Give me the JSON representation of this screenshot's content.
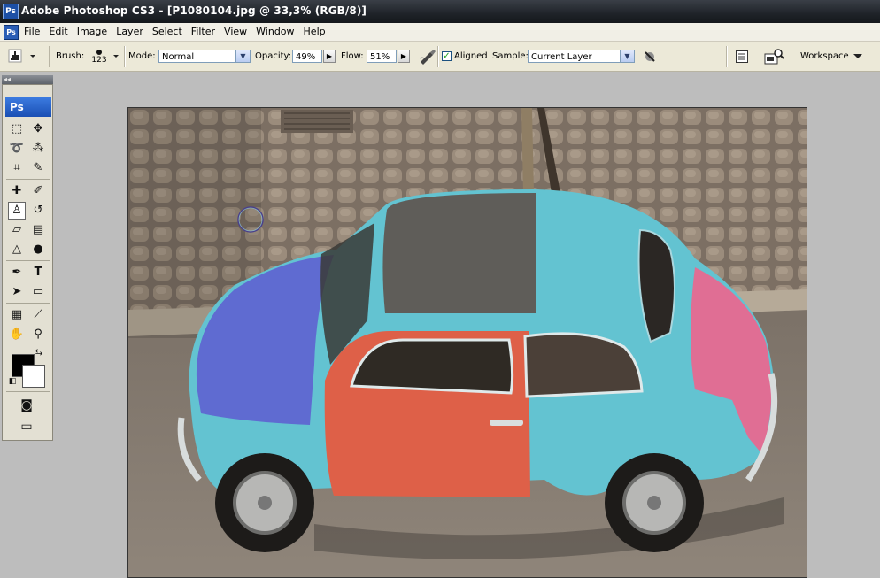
{
  "window": {
    "app_icon": "Ps",
    "title": "Adobe Photoshop CS3 - [P1080104.jpg @ 33,3% (RGB/8)]"
  },
  "menubar": {
    "doc_icon": "Ps",
    "items": [
      "File",
      "Edit",
      "Image",
      "Layer",
      "Select",
      "Filter",
      "View",
      "Window",
      "Help"
    ]
  },
  "options": {
    "brush_label": "Brush:",
    "brush_size": "123",
    "mode_label": "Mode:",
    "mode_value": "Normal",
    "opacity_label": "Opacity:",
    "opacity_value": "49%",
    "flow_label": "Flow:",
    "flow_value": "51%",
    "aligned_label": "Aligned",
    "aligned_checked": true,
    "sample_label": "Sample:",
    "sample_value": "Current Layer",
    "workspace_label": "Workspace"
  },
  "tools": {
    "logo": "Ps",
    "selected_tool": "clone-stamp-tool"
  },
  "colors": {
    "foreground": "#000000",
    "background": "#ffffff"
  },
  "icons": [
    "stamp-icon",
    "chevron-down-icon",
    "airbrush-icon",
    "ignore-adjustment-icon",
    "palette-well-icon",
    "file-browser-icon"
  ]
}
